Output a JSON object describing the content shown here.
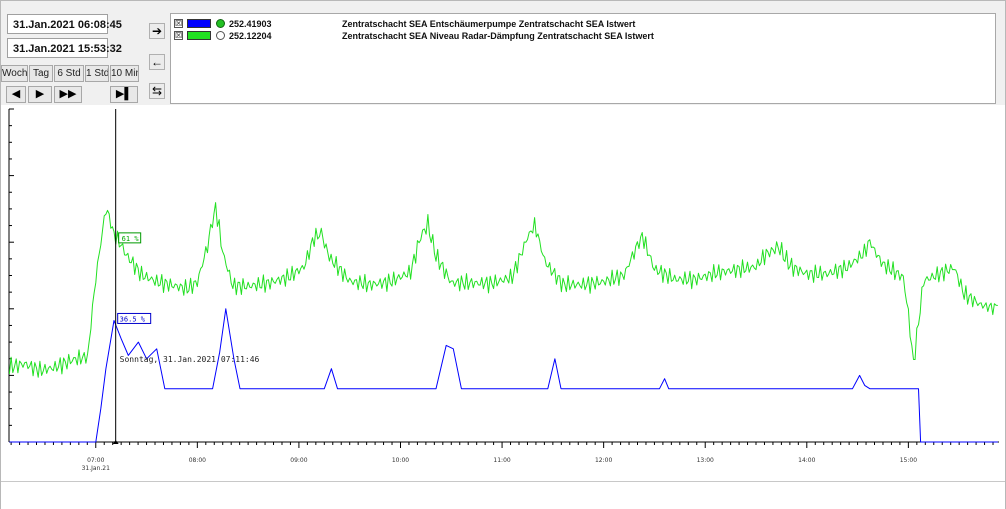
{
  "time_range": {
    "start": "31.Jan.2021   06:08:45",
    "end": "31.Jan.2021   15:53:32"
  },
  "range_buttons": [
    "Woche",
    "Tag",
    "6 Std",
    "1 Std",
    "10 Min"
  ],
  "nav_buttons": {
    "back": "◀",
    "forward": "▶",
    "fast_forward": "▶▶",
    "end": "▶▌"
  },
  "side_buttons": {
    "right": "➔",
    "left": "←",
    "swap": "⇆"
  },
  "legend": [
    {
      "checkbox": "☒",
      "color": "#0000ff",
      "icon": "status-ok-icon",
      "value": "252.41903",
      "description": "Zentratschacht SEA Entschäumerpumpe    Zentratschacht SEA    Istwert"
    },
    {
      "checkbox": "☒",
      "color": "#22e022",
      "icon": "sensor-icon",
      "value": "252.12204",
      "description": "Zentratschacht SEA Niveau Radar-Dämpfung    Zentratschacht SEA    Istwert"
    }
  ],
  "cursor": {
    "label": "Sonntag, 31.Jan.2021 07:11:46",
    "green_value": "61 %",
    "blue_value": "36.5 %"
  },
  "chart_data": {
    "type": "line",
    "x_unit": "time",
    "x_ticks": [
      "07:00",
      "08:00",
      "09:00",
      "10:00",
      "11:00",
      "12:00",
      "13:00",
      "14:00",
      "15:00"
    ],
    "x_sub_label": "31.Jan.21",
    "xlim": [
      "06:08:45",
      "15:53:32"
    ],
    "ylim": [
      0,
      100
    ],
    "series": [
      {
        "color": "#22e022",
        "points": [
          [
            6.15,
            21
          ],
          [
            6.3,
            22
          ],
          [
            6.45,
            20
          ],
          [
            6.6,
            21
          ],
          [
            6.75,
            23
          ],
          [
            6.92,
            26
          ],
          [
            7.0,
            48
          ],
          [
            7.1,
            69
          ],
          [
            7.18,
            61
          ],
          [
            7.3,
            55
          ],
          [
            7.45,
            49
          ],
          [
            7.6,
            47
          ],
          [
            7.75,
            46
          ],
          [
            7.9,
            45
          ],
          [
            8.0,
            47
          ],
          [
            8.1,
            58
          ],
          [
            8.18,
            69
          ],
          [
            8.25,
            56
          ],
          [
            8.35,
            46
          ],
          [
            8.5,
            46
          ],
          [
            8.7,
            47
          ],
          [
            8.9,
            49
          ],
          [
            9.05,
            52
          ],
          [
            9.15,
            61
          ],
          [
            9.22,
            64
          ],
          [
            9.3,
            55
          ],
          [
            9.5,
            48
          ],
          [
            9.7,
            47
          ],
          [
            9.9,
            48
          ],
          [
            10.1,
            51
          ],
          [
            10.2,
            62
          ],
          [
            10.27,
            67
          ],
          [
            10.35,
            56
          ],
          [
            10.5,
            48
          ],
          [
            10.7,
            48
          ],
          [
            10.9,
            48
          ],
          [
            11.1,
            50
          ],
          [
            11.25,
            62
          ],
          [
            11.32,
            67
          ],
          [
            11.42,
            56
          ],
          [
            11.6,
            48
          ],
          [
            11.8,
            48
          ],
          [
            12.0,
            49
          ],
          [
            12.2,
            51
          ],
          [
            12.3,
            58
          ],
          [
            12.38,
            61
          ],
          [
            12.5,
            53
          ],
          [
            12.7,
            50
          ],
          [
            12.9,
            50
          ],
          [
            13.1,
            52
          ],
          [
            13.3,
            53
          ],
          [
            13.5,
            54
          ],
          [
            13.6,
            58
          ],
          [
            13.72,
            60
          ],
          [
            13.85,
            54
          ],
          [
            14.0,
            52
          ],
          [
            14.2,
            52
          ],
          [
            14.4,
            54
          ],
          [
            14.55,
            58
          ],
          [
            14.62,
            61
          ],
          [
            14.75,
            55
          ],
          [
            14.95,
            51
          ],
          [
            15.0,
            40
          ],
          [
            15.05,
            25
          ],
          [
            15.15,
            50
          ],
          [
            15.3,
            52
          ],
          [
            15.45,
            54
          ],
          [
            15.55,
            46
          ],
          [
            15.7,
            43
          ],
          [
            15.88,
            41
          ]
        ]
      },
      {
        "color": "#0000ff",
        "points": [
          [
            6.15,
            0
          ],
          [
            6.6,
            0
          ],
          [
            7.0,
            0
          ],
          [
            7.05,
            10
          ],
          [
            7.1,
            22
          ],
          [
            7.18,
            36.5
          ],
          [
            7.25,
            31
          ],
          [
            7.32,
            26
          ],
          [
            7.42,
            30
          ],
          [
            7.5,
            25
          ],
          [
            7.6,
            28
          ],
          [
            7.68,
            16
          ],
          [
            8.0,
            16
          ],
          [
            8.15,
            16
          ],
          [
            8.22,
            27
          ],
          [
            8.28,
            40
          ],
          [
            8.36,
            25
          ],
          [
            8.42,
            16
          ],
          [
            9.0,
            16
          ],
          [
            9.25,
            16
          ],
          [
            9.32,
            22
          ],
          [
            9.38,
            16
          ],
          [
            10.0,
            16
          ],
          [
            10.35,
            16
          ],
          [
            10.45,
            29
          ],
          [
            10.52,
            28
          ],
          [
            10.6,
            16
          ],
          [
            11.0,
            16
          ],
          [
            11.45,
            16
          ],
          [
            11.52,
            25
          ],
          [
            11.58,
            16
          ],
          [
            12.0,
            16
          ],
          [
            12.55,
            16
          ],
          [
            12.6,
            19
          ],
          [
            12.64,
            16
          ],
          [
            13.0,
            16
          ],
          [
            14.45,
            16
          ],
          [
            14.52,
            20
          ],
          [
            14.57,
            17
          ],
          [
            14.62,
            16
          ],
          [
            15.0,
            16
          ],
          [
            15.1,
            16
          ],
          [
            15.12,
            0
          ],
          [
            15.88,
            0
          ]
        ]
      }
    ]
  }
}
